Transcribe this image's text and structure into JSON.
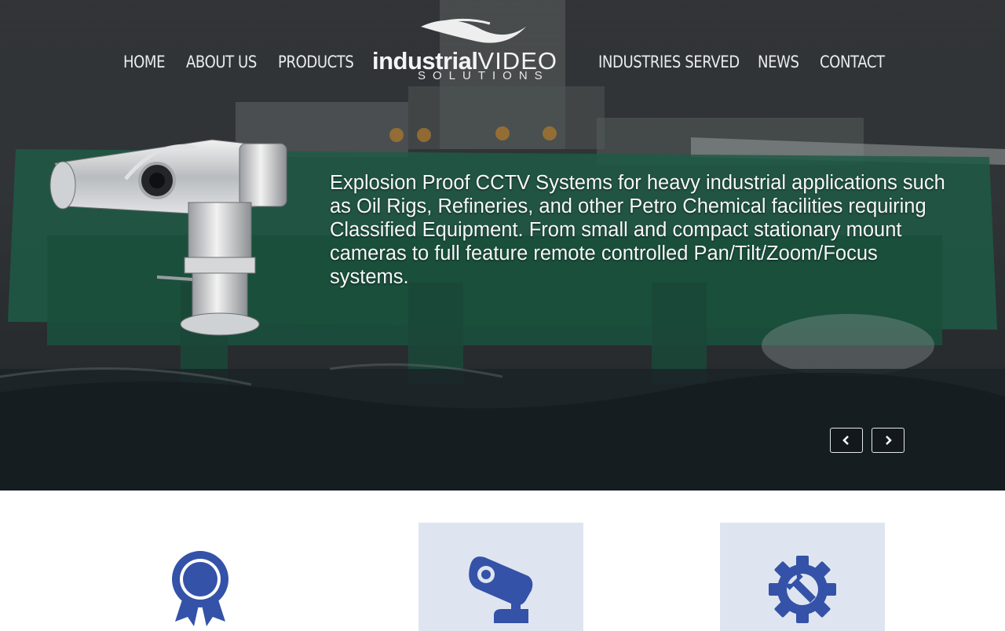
{
  "nav": {
    "home": "HOME",
    "about": "ABOUT US",
    "products": "PRODUCTS",
    "industries": "INDUSTRIES SERVED",
    "news": "NEWS",
    "contact": "CONTACT"
  },
  "logo": {
    "bold": "industrial",
    "thin": "VIDEO",
    "sub": "SOLUTIONS"
  },
  "hero": {
    "text": "Explosion Proof CCTV Systems for heavy industrial applications such as Oil Rigs, Refineries, and other Petro Chemical facilities requiring Classified Equipment. From small and compact stationary mount cameras to full feature remote controlled Pan/Tilt/Zoom/Focus systems.",
    "prev_icon": "chevron-left-icon",
    "next_icon": "chevron-right-icon"
  },
  "features": [
    {
      "icon": "award-ribbon-icon"
    },
    {
      "icon": "security-camera-icon"
    },
    {
      "icon": "gear-wrench-icon"
    }
  ],
  "colors": {
    "icon_blue": "#3452a8",
    "feature_bg": "#dfe5f0"
  }
}
